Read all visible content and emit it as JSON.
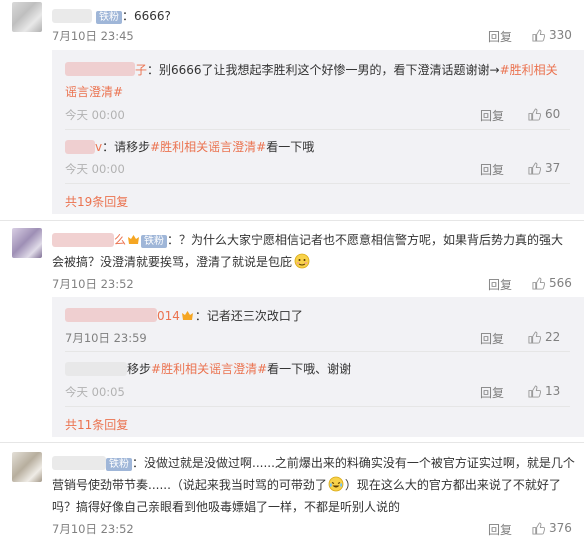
{
  "comments": [
    {
      "badge": "铁粉",
      "text": "：6666?",
      "time": "7月10日 23:45",
      "reply": "回复",
      "likes": "330",
      "subs": [
        {
          "name_suffix": "子",
          "text_1": "：别6666了让我想起李胜利这个好惨一男的，看下澄清话题谢谢→",
          "tag_1": "#胜利相关",
          "tag_2": "谣言澄清#",
          "time": "今天 00:00",
          "reply": "回复",
          "likes": "60"
        },
        {
          "name_suffix": "v",
          "text_1": "：请移步",
          "tag_1": "#胜利相关谣言澄清#",
          "text_2": "看一下哦",
          "time": "今天 00:00",
          "reply": "回复",
          "likes": "37"
        }
      ],
      "more": "共19条回复"
    },
    {
      "name_suffix": "么",
      "badge": "铁粉",
      "text_1": "：？为什么大家宁愿相信记者也不愿意相信警方呢，如果背后势力真的强大",
      "text_2": "会被搞？没澄清就要挨骂，澄清了就说是包庇",
      "time": "7月10日 23:52",
      "reply": "回复",
      "likes": "566",
      "subs": [
        {
          "name_suffix": "014",
          "text_1": "：记者还三次改口了",
          "time": "7月10日 23:59",
          "reply": "回复",
          "likes": "22"
        },
        {
          "text_1": "移步",
          "tag_1": "#胜利相关谣言澄清#",
          "text_2": "看一下哦、谢谢",
          "time": "今天 00:05",
          "reply": "回复",
          "likes": "13"
        }
      ],
      "more": "共11条回复"
    },
    {
      "badge": "铁粉",
      "text_1": "：没做过就是没做过啊......之前爆出来的料确实没有一个被官方证实过啊，就是几个",
      "text_2": "营销号使劲带节奏......（说起来我当时骂的可带劲了",
      "text_2b": "）现在这么大的官方都出来说了不就好了",
      "text_3": "吗？搞得好像自己亲眼看到他吸毒嫖娼了一样，不都是听别人说的",
      "time": "7月10日 23:52",
      "reply": "回复",
      "likes": "376"
    }
  ],
  "colors": {
    "accent": "#eb7350",
    "badge": "#9fb6d8",
    "subbg": "#f2f2f5"
  }
}
